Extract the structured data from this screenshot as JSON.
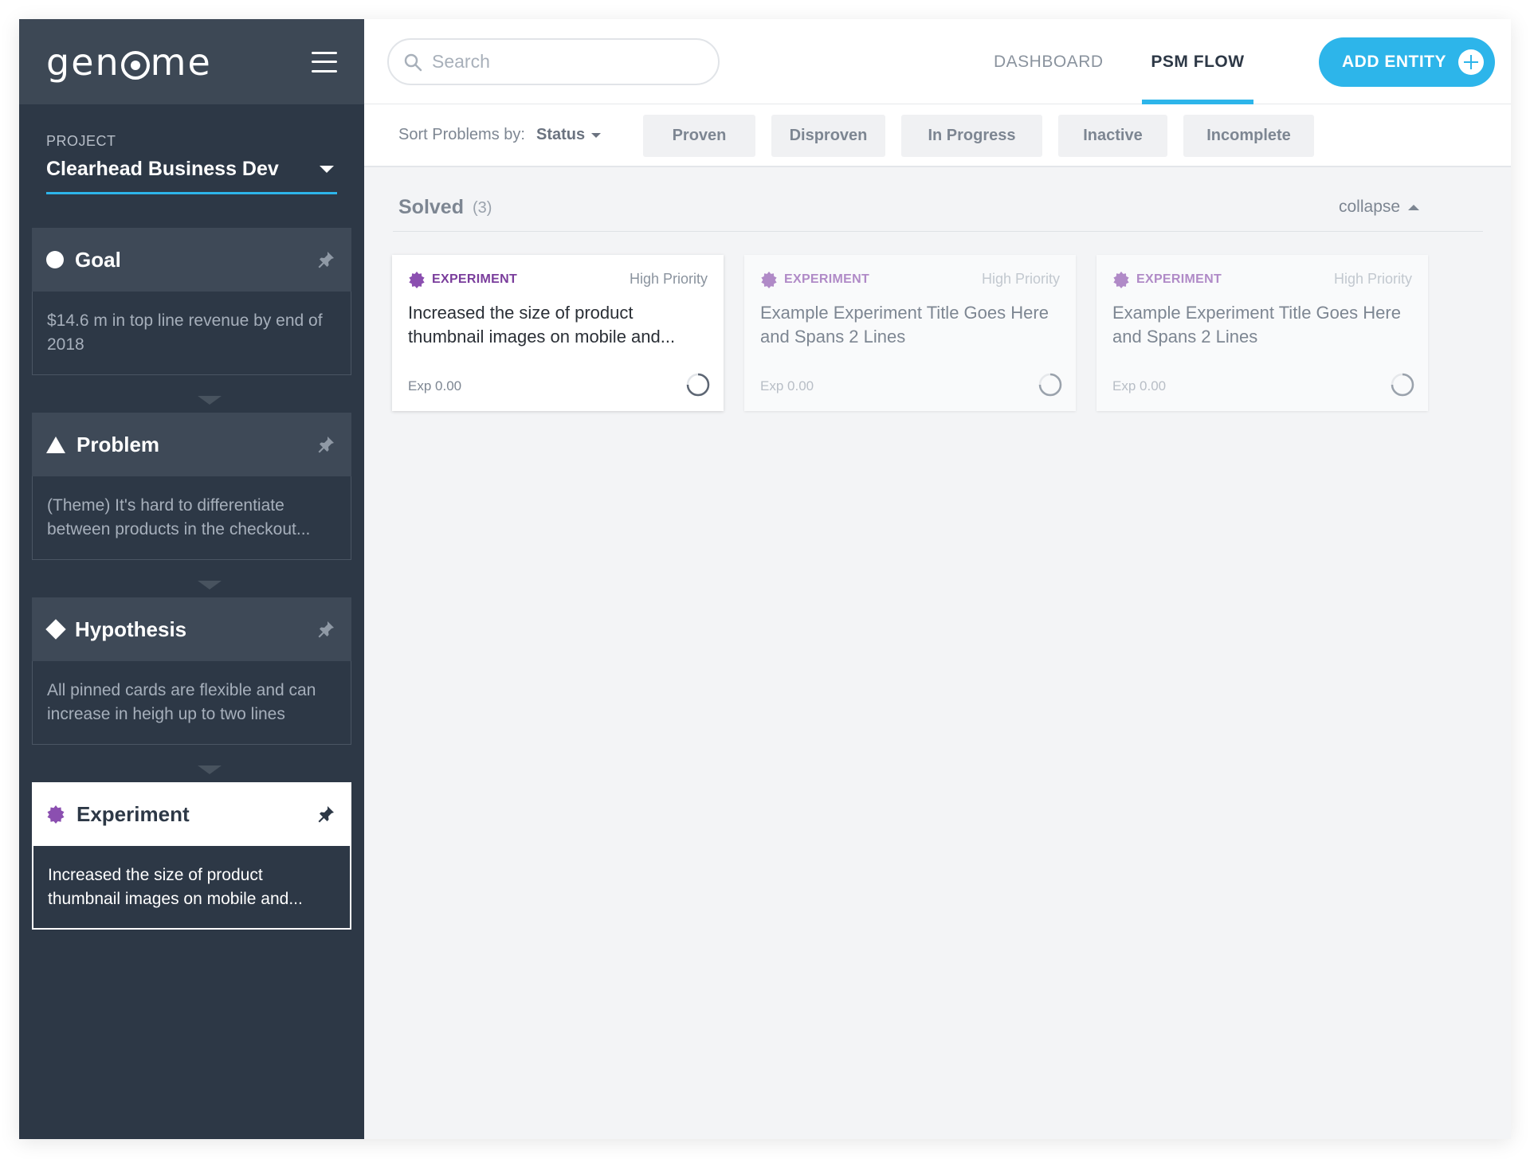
{
  "brand": {
    "logo_left": "gen",
    "logo_right": "me"
  },
  "project": {
    "label": "PROJECT",
    "name": "Clearhead Business Dev"
  },
  "pinned": [
    {
      "title": "Goal",
      "body": "$14.6 m in top line revenue by end of 2018",
      "symbol": "circle"
    },
    {
      "title": "Problem",
      "body": "(Theme) It's hard to differentiate between products in the checkout...",
      "symbol": "triangle"
    },
    {
      "title": "Hypothesis",
      "body": "All pinned cards are flexible and can increase in heigh up to two lines",
      "symbol": "diamond"
    },
    {
      "title": "Experiment",
      "body": "Increased the size of product thumbnail images on mobile and...",
      "symbol": "badge"
    }
  ],
  "search": {
    "placeholder": "Search"
  },
  "nav": {
    "dashboard": "DASHBOARD",
    "psm_flow": "PSM FLOW",
    "add_entity": "ADD ENTITY"
  },
  "filters": {
    "sort_label": "Sort Problems by:",
    "sort_value": "Status",
    "chips": [
      "Proven",
      "Disproven",
      "In Progress",
      "Inactive",
      "Incomplete"
    ]
  },
  "group": {
    "title": "Solved",
    "count": "(3)",
    "collapse_label": "collapse"
  },
  "cards": [
    {
      "type": "EXPERIMENT",
      "priority": "High Priority",
      "title": "Increased the size of product thumbnail images on mobile and...",
      "meta": "Exp 0.00"
    },
    {
      "type": "EXPERIMENT",
      "priority": "High Priority",
      "title": "Example Experiment Title Goes Here and Spans 2 Lines",
      "meta": "Exp 0.00"
    },
    {
      "type": "EXPERIMENT",
      "priority": "High Priority",
      "title": "Example Experiment Title Goes Here and Spans 2 Lines",
      "meta": "Exp 0.00"
    }
  ],
  "colors": {
    "accent": "#2db5ea",
    "sidebar": "#2d3846",
    "experiment": "#7a3d9c"
  },
  "icons": [
    "search-icon",
    "menu-icon",
    "pin-icon",
    "experiment-badge-icon",
    "plus-icon",
    "spinner-icon"
  ]
}
